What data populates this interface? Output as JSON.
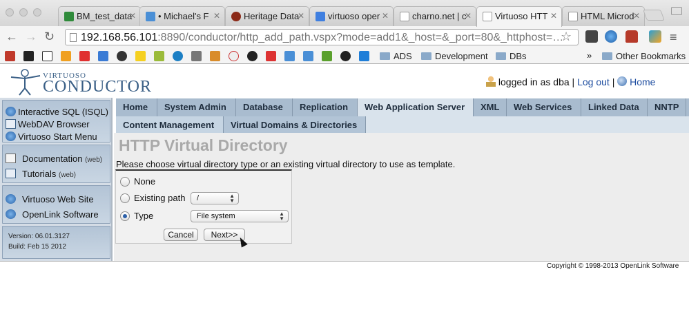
{
  "browser": {
    "tabs": [
      {
        "title": "BM_test_data",
        "favicon_color": "#2f8a3a"
      },
      {
        "title": "• Michael's F",
        "favicon_color": "#4a8fd6"
      },
      {
        "title": "Heritage Data",
        "favicon_color": "#8b2a18"
      },
      {
        "title": "virtuoso oper",
        "favicon_color": "#3f7fe0"
      },
      {
        "title": "charno.net | c",
        "favicon_color": "#cfcfcf"
      },
      {
        "title": "Virtuoso HTT",
        "favicon_color": "#cfcfcf"
      },
      {
        "title": "HTML Microd",
        "favicon_color": "#cfcfcf"
      }
    ],
    "active_tab_index": 5,
    "url_host": "192.168.56.101",
    "url_rest": ":8890/conductor/http_add_path.vspx?mode=add1&_host=&_port=80&_httphost=…",
    "bookmarks": {
      "folders": [
        "ADS",
        "Development",
        "DBs",
        "Other Bookmarks"
      ],
      "overflow": "»"
    }
  },
  "header": {
    "logo_small": "VIRTUOSO",
    "logo_big": "CONDUCTOR",
    "logged_in_text": "logged in as dba",
    "separator": "|",
    "logout_link": "Log out",
    "home_link": "Home"
  },
  "sidebar": {
    "group1": [
      "Interactive SQL (ISQL)",
      "WebDAV Browser",
      "Virtuoso Start Menu"
    ],
    "group2": [
      {
        "label": "Documentation",
        "note": "(web)"
      },
      {
        "label": "Tutorials",
        "note": "(web)"
      }
    ],
    "group3": [
      "Virtuoso Web Site",
      "OpenLink Software"
    ],
    "version": "Version: 06.01.3127",
    "build": "Build: Feb 15 2012"
  },
  "main_tabs": [
    "Home",
    "System Admin",
    "Database",
    "Replication",
    "Web Application Server",
    "XML",
    "Web Services",
    "Linked Data",
    "NNTP"
  ],
  "active_main_tab": "Web Application Server",
  "sub_tabs": [
    "Content Management",
    "Virtual Domains & Directories"
  ],
  "active_sub_tab": "Virtual Domains & Directories",
  "page": {
    "title": "HTTP Virtual Directory",
    "prompt": "Please choose virtual directory type or an existing virtual directory to use as template.",
    "options": {
      "none_label": "None",
      "existing_label": "Existing path",
      "existing_value": "/",
      "type_label": "Type",
      "type_value": "File system",
      "selected": "Type"
    },
    "cancel_label": "Cancel",
    "next_label": "Next>>"
  },
  "footer": {
    "copyright": "Copyright © 1998-2013 OpenLink Software"
  }
}
